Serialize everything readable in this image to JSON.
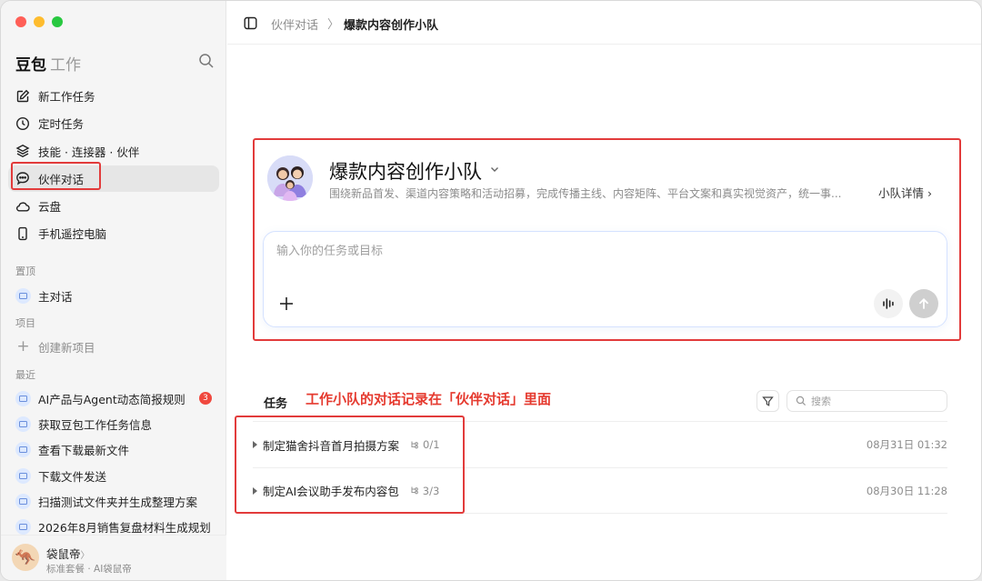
{
  "colors": {
    "accent": "#e23b3b",
    "traffic_red": "#ff5f57",
    "traffic_yellow": "#febc2e",
    "traffic_green": "#28c840",
    "badge": "#f0483e"
  },
  "sidebar": {
    "brand": "豆包",
    "brand_sub": "工作",
    "nav": [
      {
        "label": "新工作任务",
        "icon": "edit-icon"
      },
      {
        "label": "定时任务",
        "icon": "clock-icon"
      },
      {
        "label": "技能 · 连接器 · 伙伴",
        "icon": "layers-icon"
      },
      {
        "label": "伙伴对话",
        "icon": "chat-bubble-icon",
        "active": true
      },
      {
        "label": "云盘",
        "icon": "cloud-icon"
      },
      {
        "label": "手机遥控电脑",
        "icon": "phone-icon"
      }
    ],
    "pinned_label": "置顶",
    "pinned": [
      {
        "label": "主对话"
      }
    ],
    "projects_label": "项目",
    "new_project": "创建新项目",
    "recent_label": "最近",
    "recent": [
      {
        "label": "AI产品与Agent动态简报规则",
        "badge": "3"
      },
      {
        "label": "获取豆包工作任务信息"
      },
      {
        "label": "查看下载最新文件"
      },
      {
        "label": "下载文件发送"
      },
      {
        "label": "扫描测试文件夹并生成整理方案"
      },
      {
        "label": "2026年8月销售复盘材料生成规划"
      }
    ],
    "profile": {
      "name": "袋鼠帝",
      "name_suffix": "〉",
      "plan": "标准套餐 · AI袋鼠帝"
    }
  },
  "header": {
    "breadcrumb_parent": "伙伴对话",
    "breadcrumb_sep": "〉",
    "breadcrumb_current": "爆款内容创作小队"
  },
  "team": {
    "name": "爆款内容创作小队",
    "description": "围绕新品首发、渠道内容策略和活动招募，完成传播主线、内容矩阵、平台文案和真实视觉资产，统一事...",
    "detail_link": "小队详情 ›"
  },
  "composer": {
    "placeholder": "输入你的任务或目标"
  },
  "annotation": "工作小队的对话记录在「伙伴对话」里面",
  "tasks": {
    "title": "任务",
    "search_placeholder": "搜索",
    "items": [
      {
        "name": "制定猫舍抖音首月拍摄方案",
        "progress": "0/1",
        "time": "08月31日 01:32"
      },
      {
        "name": "制定AI会议助手发布内容包",
        "progress": "3/3",
        "time": "08月30日 11:28"
      }
    ]
  }
}
